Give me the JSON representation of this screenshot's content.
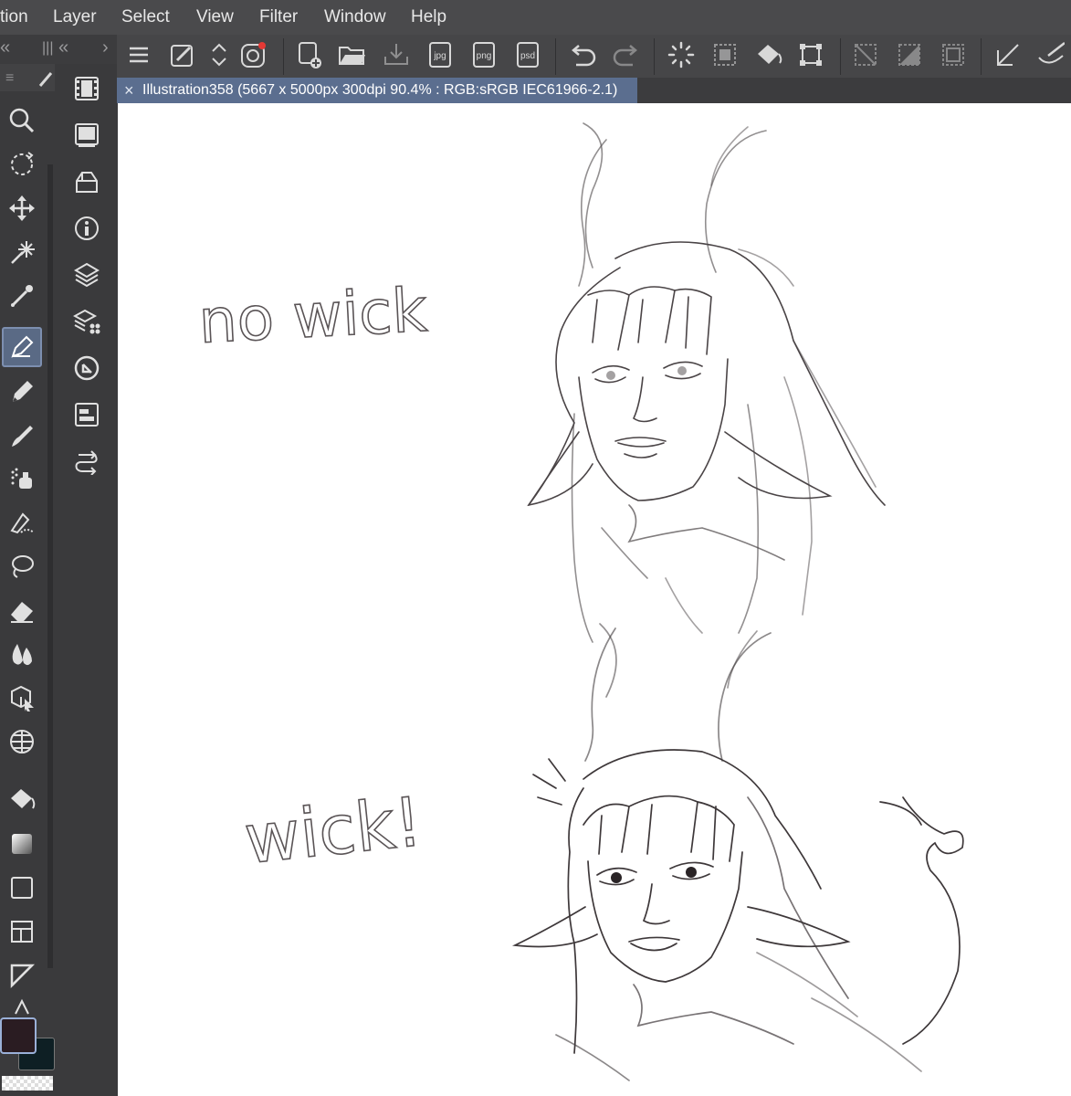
{
  "menubar": {
    "items": [
      "tion",
      "Layer",
      "Select",
      "View",
      "Filter",
      "Window",
      "Help"
    ]
  },
  "subbar": {
    "left_chevrons": "«",
    "grip": "|||",
    "right_chevrons": "«",
    "right_arrow": "›"
  },
  "toolbar": {
    "icons": [
      "menu-icon",
      "eyedropper-settings-icon",
      "updown-arrows-icon",
      "companion-app-icon",
      "new-canvas-icon",
      "open-folder-icon",
      "save-download-icon",
      "export-jpg-icon",
      "export-png-icon",
      "export-psd-icon",
      "undo-icon",
      "redo-icon",
      "selection-loading-icon",
      "dashed-select-icon",
      "fill-bucket-icon",
      "transform-icon",
      "clear-selection-icon",
      "invert-selection-icon",
      "select-all-icon",
      "ruler-icon",
      "brush-sketch-icon"
    ],
    "labels": {
      "jpg": "jpg",
      "png": "png",
      "psd": "psd"
    }
  },
  "tab": {
    "close": "×",
    "title": "Illustration358 (5667 x 5000px 300dpi 90.4% : RGB:sRGB IEC61966-2.1)"
  },
  "tools": [
    "zoom-icon",
    "rotate-view-icon",
    "move-icon",
    "auto-select-icon",
    "eyedropper-icon",
    "pen-icon",
    "pencil-icon",
    "brush-icon",
    "airbrush-icon",
    "decoration-icon",
    "lasso-fill-icon",
    "eraser-icon",
    "blend-icon",
    "3d-object-icon",
    "perspective-ruler-icon",
    "fill-icon",
    "gradient-icon",
    "rectangle-icon",
    "frame-border-icon",
    "direct-draw-icon"
  ],
  "subtools": [
    "film-icon",
    "layer-property-icon",
    "material-icon",
    "info-icon",
    "layers-icon",
    "layer-search-icon",
    "navigator-icon",
    "timeline-icon",
    "auto-action-icon"
  ],
  "canvas": {
    "text_top": "no wick",
    "text_bottom": "wick!"
  },
  "colors": {
    "main": "#2a1c22",
    "sub": "#0e1f24",
    "accent": "#5b6e8f"
  }
}
